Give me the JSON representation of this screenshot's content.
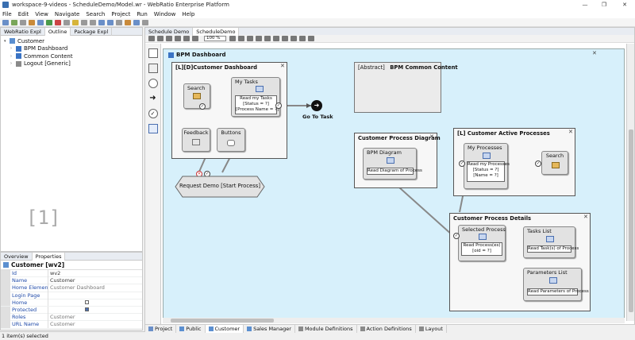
{
  "window": {
    "title": "workspace-9-videos - ScheduleDemo/Model.wr - WebRatio Enterprise Platform",
    "minimize": "—",
    "restore": "❐",
    "close": "✕"
  },
  "menu": [
    "File",
    "Edit",
    "View",
    "Navigate",
    "Search",
    "Project",
    "Run",
    "Window",
    "Help"
  ],
  "left_tabs": [
    {
      "label": "WebRatio Expl",
      "active": false
    },
    {
      "label": "Outline",
      "active": true
    },
    {
      "label": "Package Expl",
      "active": false
    }
  ],
  "tree": [
    {
      "label": "Customer",
      "level": 0,
      "expanded": true,
      "selected": true,
      "icon_color": "#5b8fd0"
    },
    {
      "label": "BPM Dashboard",
      "level": 1,
      "icon_color": "#3a73c4"
    },
    {
      "label": "Common Content",
      "level": 1,
      "icon_color": "#3a73c4"
    },
    {
      "label": "Logout [Generic]",
      "level": 1,
      "icon_color": "#8a8a8a"
    }
  ],
  "outline_placeholder": "[1]",
  "props_tabs": [
    {
      "label": "Overview",
      "active": false
    },
    {
      "label": "Properties",
      "active": true
    }
  ],
  "props": {
    "header": "Customer [wv2]",
    "rows": [
      {
        "key": "Id",
        "value": "wv2"
      },
      {
        "key": "Name",
        "value": "Customer"
      },
      {
        "key": "Home Element",
        "value": "Customer Dashboard"
      },
      {
        "key": "Login Page",
        "value": ""
      },
      {
        "key": "Home",
        "value": "",
        "checkbox": true,
        "checked": false
      },
      {
        "key": "Protected",
        "value": "",
        "checkbox": true,
        "checked": true
      },
      {
        "key": "Roles",
        "value": "Customer"
      },
      {
        "key": "URL Name",
        "value": "Customer"
      }
    ]
  },
  "status": "1 item(s) selected",
  "editor_tabs": [
    {
      "label": "Schedule Demo",
      "active": false
    },
    {
      "label": "ScheduleDemo",
      "active": true
    }
  ],
  "zoom": "100 %",
  "bottom_tabs": [
    "Project",
    "Public",
    "Customer",
    "Sales Manager",
    "Module Definitions",
    "Action Definitions",
    "Layout"
  ],
  "bottom_active": "Customer",
  "diagram": {
    "title": "BPM Dashboard",
    "customer_dashboard": {
      "title": "[L][D]Customer Dashboard",
      "search": "Search",
      "my_tasks": "My Tasks",
      "my_tasks_inner": [
        "Read my Tasks",
        "[Status = ?]",
        "[Process Name = ?]"
      ],
      "feedback": "Feedback",
      "buttons": "Buttons"
    },
    "go_to_task": "Go To Task",
    "request_demo": "Request Demo [Start Process]",
    "common_content": {
      "prefix": "[Abstract]",
      "title": "BPM Common Content"
    },
    "process_diagram": {
      "title": "Customer Process Diagram",
      "unit": "BPM Diagram",
      "inner": "Read Diagram of Process"
    },
    "active_processes": {
      "title": "[L] Customer Active Processes",
      "my_processes": "My Processes",
      "inner": [
        "Read my Processes",
        "[Status = ?]",
        "[Name = ?]"
      ],
      "search": "Search"
    },
    "process_details": {
      "title": "Customer Process Details",
      "selected": "Selected Process",
      "selected_inner": [
        "Read Process(es)",
        "[oid = ?]"
      ],
      "tasks": "Tasks List",
      "tasks_inner": "Read Task(s) of Process",
      "params": "Parameters List",
      "params_inner": "Read Parameters of Process"
    }
  }
}
